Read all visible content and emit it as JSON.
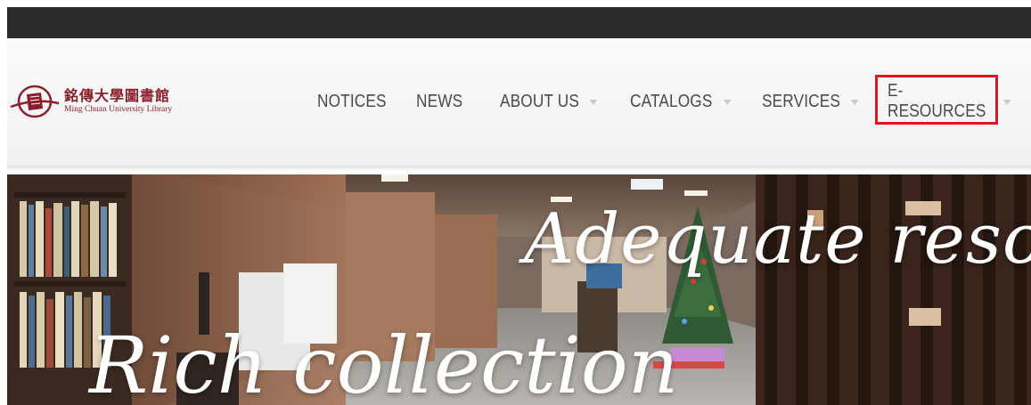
{
  "logo": {
    "chinese": "銘傳大學圖書館",
    "english": "Ming Chuan University Library",
    "icon": "library-emblem-icon"
  },
  "nav": {
    "items": [
      {
        "label": "NOTICES",
        "has_dropdown": false
      },
      {
        "label": "NEWS",
        "has_dropdown": false
      },
      {
        "label": "ABOUT US",
        "has_dropdown": true
      },
      {
        "label": "CATALOGS",
        "has_dropdown": true
      },
      {
        "label": "SERVICES",
        "has_dropdown": true
      },
      {
        "label": "E-RESOURCES",
        "has_dropdown": true,
        "highlighted": true
      }
    ]
  },
  "hero": {
    "caption_top": "Adequate reso",
    "caption_bottom": "Rich collection"
  },
  "colors": {
    "top_bar": "#2b2b2b",
    "brand": "#8a1f2b",
    "highlight": "#e0141e",
    "nav_text": "#4a4a4a"
  }
}
